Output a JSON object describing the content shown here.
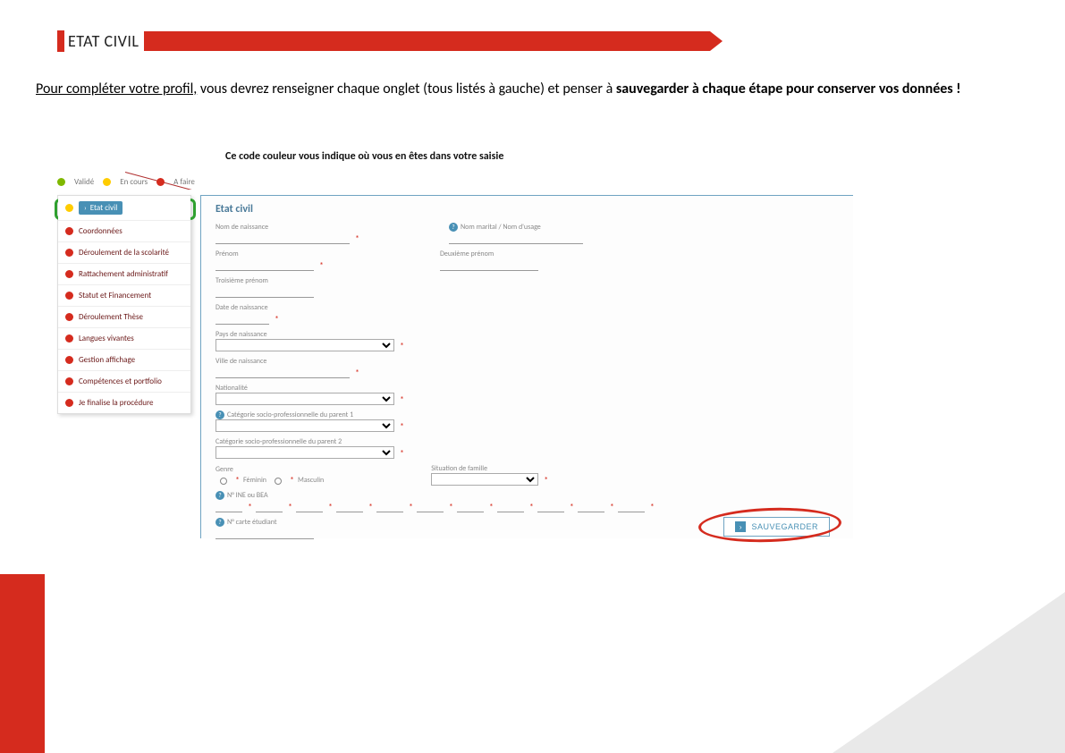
{
  "banner": {
    "title": "ETAT CIVIL"
  },
  "intro": {
    "line1a": "Pour compléter votre profil,",
    "line1b": " vous devrez renseigner chaque onglet (tous listés à gauche) et penser à ",
    "bold1": "sauvegarder à chaque étape pour conserver vos données !"
  },
  "callout1": "Ce code couleur vous indique où vous en êtes dans votre saisie",
  "legend": {
    "l1": "Validé",
    "l2": "En cours",
    "l3": "A faire"
  },
  "nav": {
    "items": [
      {
        "label": "Etat civil",
        "color": "yellow",
        "active": true
      },
      {
        "label": "Coordonnées",
        "color": "red"
      },
      {
        "label": "Déroulement de la scolarité",
        "color": "red"
      },
      {
        "label": "Rattachement administratif",
        "color": "red"
      },
      {
        "label": "Statut et Financement",
        "color": "red"
      },
      {
        "label": "Déroulement Thèse",
        "color": "red"
      },
      {
        "label": "Langues vivantes",
        "color": "red"
      },
      {
        "label": "Gestion affichage",
        "color": "red"
      },
      {
        "label": "Compétences et portfolio",
        "color": "red"
      },
      {
        "label": "Je finalise la procédure",
        "color": "red"
      }
    ]
  },
  "form": {
    "title": "Etat civil",
    "f_nom_naissance": "Nom de naissance",
    "f_nom_marital": "Nom marital / Nom d'usage",
    "f_prenom": "Prénom",
    "f_prenom2": "Deuxième prénom",
    "f_prenom3": "Troisième prénom",
    "f_date_naiss": "Date de naissance",
    "f_pays_naiss": "Pays de naissance",
    "f_ville_naiss": "Ville de naissance",
    "f_nationalite": "Nationalité",
    "f_csp1": "Catégorie socio-professionnelle du parent 1",
    "f_csp2": "Catégorie socio-professionnelle du parent 2",
    "f_genre": "Genre",
    "f_feminin": "Féminin",
    "f_masculin": "Masculin",
    "f_situation": "Situation de famille",
    "f_ine": "N° INE ou BEA",
    "f_etudiant": "N° carte étudiant",
    "save": "SAUVEGARDER"
  }
}
